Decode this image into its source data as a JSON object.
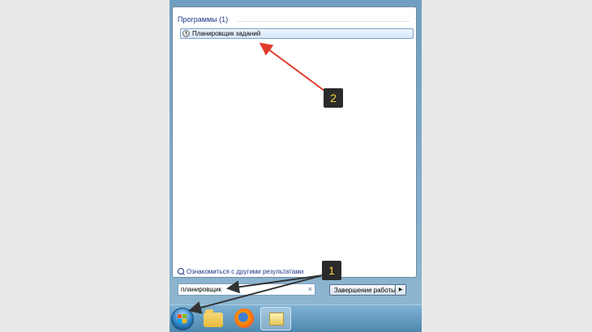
{
  "start_menu": {
    "group_header": "Программы (1)",
    "result_item": "Планировщик заданий",
    "more_results": "Ознакомиться с другими результатами",
    "search": {
      "value": "планировщик",
      "clear_glyph": "×"
    },
    "shutdown": {
      "label": "Завершение работы",
      "arrow_glyph": "▶"
    }
  },
  "annotations": {
    "badge_1": "1",
    "badge_2": "2",
    "arrow_colors": {
      "red": "#e0392b",
      "black": "#333333"
    }
  },
  "taskbar": {
    "icons": [
      "windows-start-orb-icon",
      "windows-explorer-icon",
      "firefox-icon",
      "active-app-icon"
    ]
  }
}
